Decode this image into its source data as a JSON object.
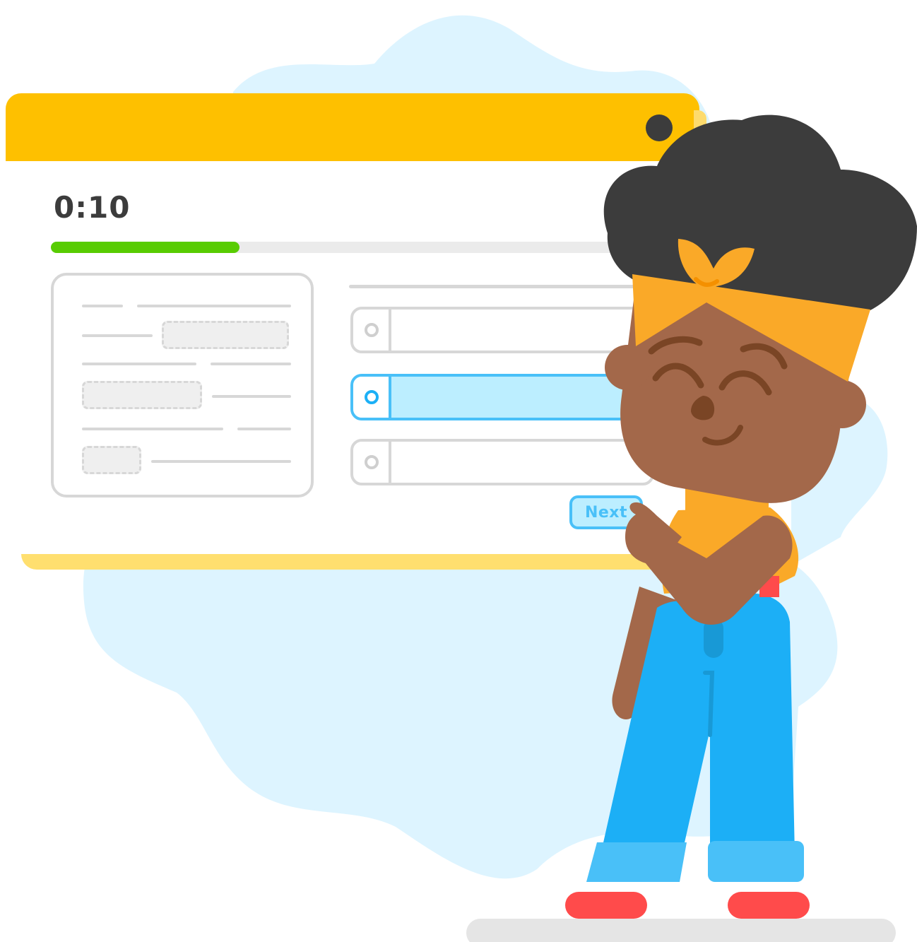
{
  "quiz": {
    "timer": "0:10",
    "progress_fraction": 0.31,
    "options_count": 3,
    "selected_option_index": 1,
    "next_label": "Next"
  },
  "colors": {
    "titlebar": "#FEC000",
    "progress_fill": "#58CC02",
    "selected_option": "#BCEEFF",
    "selected_border": "#49C0F8",
    "background_blob": "#DDF4FF",
    "character_skin": "#A3684A",
    "character_hair": "#3C3C3C",
    "headband": "#FAA928",
    "pants": "#1CAFF6",
    "shoes": "#FF4B4B"
  },
  "icons": [
    "window-close-dot-icon",
    "radio-icon"
  ]
}
